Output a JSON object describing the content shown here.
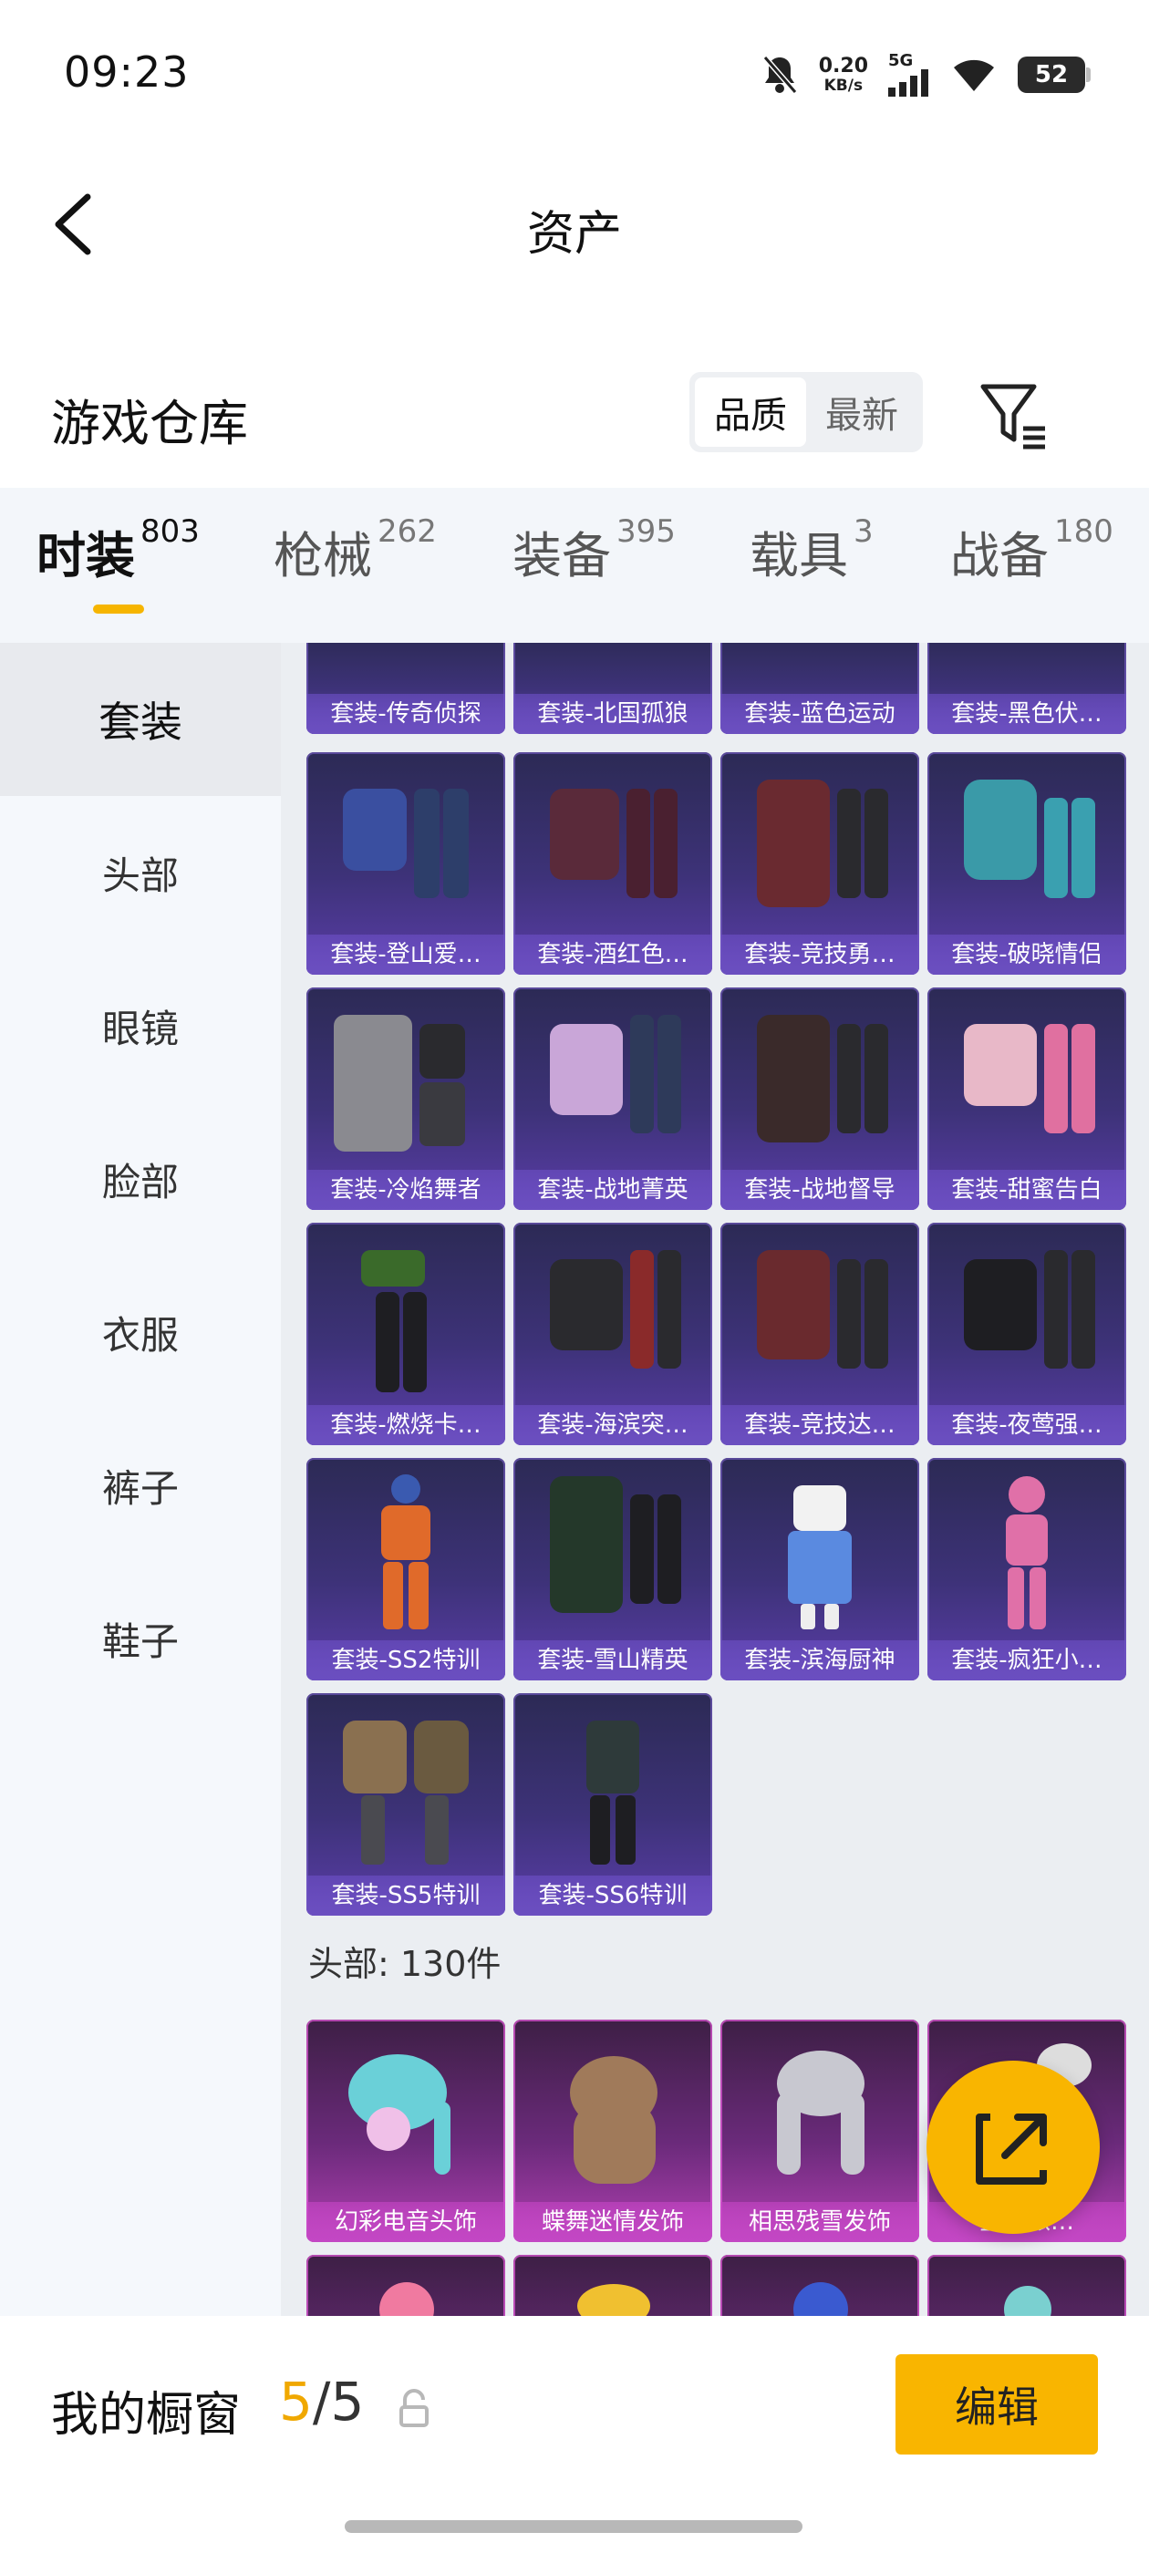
{
  "status_bar": {
    "time": "09:23",
    "net_speed_value": "0.20",
    "net_speed_unit": "KB/s",
    "network_type": "5G",
    "battery": "52",
    "icons": [
      "bell-muted-icon",
      "signal-icon",
      "wifi-icon",
      "battery-icon"
    ]
  },
  "header": {
    "title": "资产",
    "back_icon": "chevron-left-icon"
  },
  "warehouse": {
    "title": "游戏仓库",
    "sort_options": [
      "品质",
      "最新"
    ],
    "sort_selected": "品质",
    "filter_icon": "filter-icon"
  },
  "tabs": [
    {
      "name": "时装",
      "count": "803",
      "active": true
    },
    {
      "name": "枪械",
      "count": "262",
      "active": false
    },
    {
      "name": "装备",
      "count": "395",
      "active": false
    },
    {
      "name": "载具",
      "count": "3",
      "active": false
    },
    {
      "name": "战备",
      "count": "180",
      "active": false
    }
  ],
  "sidebar": {
    "items": [
      "套装",
      "头部",
      "眼镜",
      "脸部",
      "衣服",
      "裤子",
      "鞋子"
    ],
    "active": "套装"
  },
  "suits": {
    "partial_row": [
      "套装-传奇侦探",
      "套装-北国孤狼",
      "套装-蓝色运动",
      "套装-黑色伏…"
    ],
    "items": [
      "套装-登山爱…",
      "套装-酒红色…",
      "套装-竞技勇…",
      "套装-破晓情侣",
      "套装-冷焰舞者",
      "套装-战地菁英",
      "套装-战地督导",
      "套装-甜蜜告白",
      "套装-燃烧卡…",
      "套装-海滨突…",
      "套装-竞技达…",
      "套装-夜莺强…",
      "套装-SS2特训",
      "套装-雪山精英",
      "套装-滨海厨神",
      "套装-疯狂小…",
      "套装-SS5特训",
      "套装-SS6特训"
    ]
  },
  "head_section": {
    "heading": "头部: 130件",
    "items": [
      "幻彩电音头饰",
      "蝶舞迷情发饰",
      "相思残雪发饰",
      "宝…派…"
    ]
  },
  "fab": {
    "icon": "share-external-icon"
  },
  "showcase": {
    "label": "我的橱窗",
    "current": "5",
    "separator": "/",
    "total": "5",
    "lock_icon": "lock-icon",
    "edit_label": "编辑"
  },
  "colors": {
    "accent": "#f9b500",
    "card_purple": "#3d3278",
    "card_pink": "#b03fb0"
  }
}
